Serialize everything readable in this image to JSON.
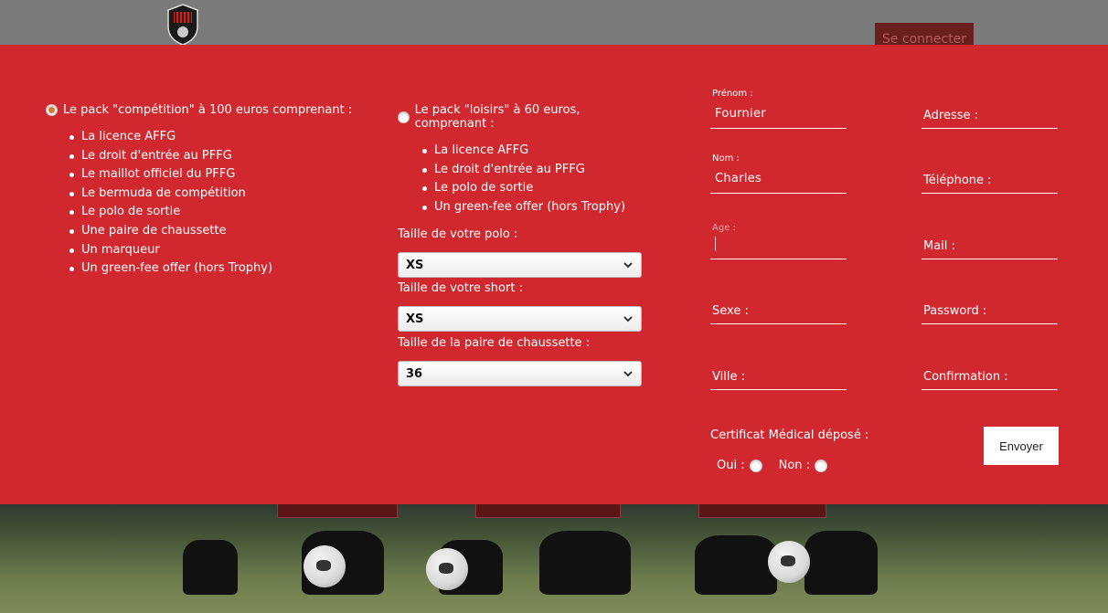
{
  "header": {
    "login_label": "Se connecter"
  },
  "pack_competition": {
    "title": "Le pack \"compétition\" à 100 euros comprenant :",
    "items": [
      "La licence AFFG",
      "Le droit d'entrée au PFFG",
      "Le maillot officiel du PFFG",
      "Le bermuda de compétition",
      "Le polo de sortie",
      "Une paire de chaussette",
      "Un marqueur",
      "Un green-fee offer (hors Trophy)"
    ],
    "selected": true
  },
  "pack_loisirs": {
    "title": "Le pack \"loisirs\" à 60 euros, comprenant :",
    "items": [
      "La licence AFFG",
      "Le droit d'entrée au PFFG",
      "Le polo de sortie",
      "Un green-fee offer (hors Trophy)"
    ],
    "selected": false
  },
  "sizes": {
    "polo": {
      "label": "Taille de votre polo :",
      "value": "XS"
    },
    "short": {
      "label": "Taille de votre short :",
      "value": "XS"
    },
    "chaussette": {
      "label": "Taille de la paire de chaussette :",
      "value": "36"
    }
  },
  "form": {
    "prenom": {
      "small_label": "Prénom :",
      "value": "Fournier"
    },
    "nom": {
      "small_label": "Nom :",
      "value": "Charles"
    },
    "age": {
      "small_label": "Age :",
      "value": ""
    },
    "sexe": {
      "label": "Sexe :"
    },
    "ville": {
      "label": "Ville :"
    },
    "adresse": {
      "label": "Adresse :"
    },
    "telephone": {
      "label": "Téléphone :"
    },
    "mail": {
      "label": "Mail :"
    },
    "password": {
      "label": "Password :"
    },
    "confirmation": {
      "label": "Confirmation :"
    }
  },
  "certificat": {
    "label": "Certificat Médical déposé :",
    "oui": "Oui :",
    "non": "Non :"
  },
  "submit_label": "Envoyer",
  "colors": {
    "modal_bg": "#d0282e",
    "radio_checked": "#d9772c"
  }
}
